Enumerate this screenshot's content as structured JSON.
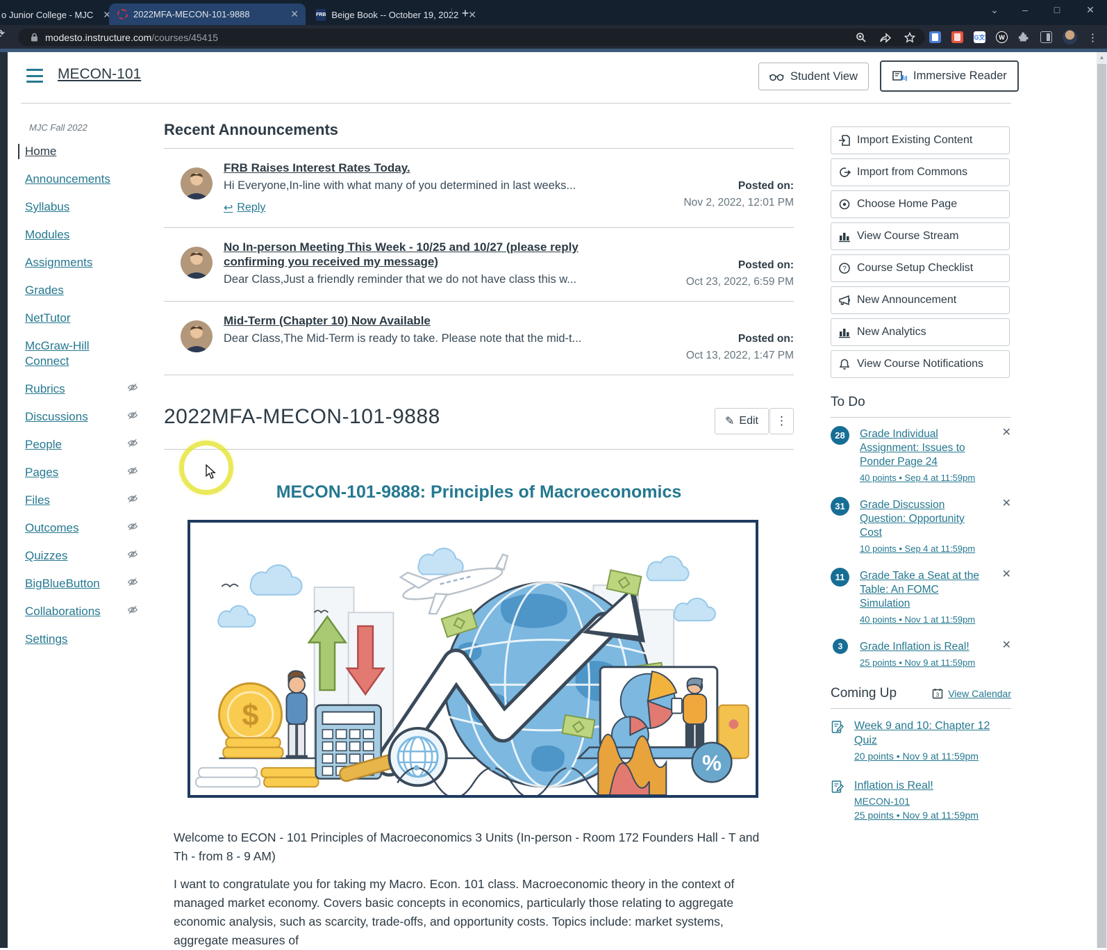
{
  "browser": {
    "tabs": [
      {
        "title": "o Junior College - MJC"
      },
      {
        "title": "2022MFA-MECON-101-9888"
      },
      {
        "title": "Beige Book -- October 19, 2022",
        "favicon": "FRB"
      }
    ],
    "url_host": "modesto.instructure.com",
    "url_path": "/courses/45415"
  },
  "header": {
    "course_link": "MECON-101",
    "student_view": "Student View",
    "immersive_reader": "Immersive Reader"
  },
  "sidebar": {
    "term": "MJC Fall 2022",
    "items": [
      {
        "label": "Home"
      },
      {
        "label": "Announcements"
      },
      {
        "label": "Syllabus"
      },
      {
        "label": "Modules"
      },
      {
        "label": "Assignments"
      },
      {
        "label": "Grades"
      },
      {
        "label": "NetTutor"
      },
      {
        "label": "McGraw-Hill Connect"
      },
      {
        "label": "Rubrics"
      },
      {
        "label": "Discussions"
      },
      {
        "label": "People"
      },
      {
        "label": "Pages"
      },
      {
        "label": "Files"
      },
      {
        "label": "Outcomes"
      },
      {
        "label": "Quizzes"
      },
      {
        "label": "BigBlueButton"
      },
      {
        "label": "Collaborations"
      },
      {
        "label": "Settings"
      }
    ]
  },
  "announcements": {
    "heading": "Recent Announcements",
    "posted_label": "Posted on:",
    "reply_label": "Reply",
    "items": [
      {
        "title": "FRB Raises Interest Rates Today.",
        "preview": "Hi Everyone,In-line with what many of you determined in last weeks...",
        "date": "Nov 2, 2022, 12:01 PM"
      },
      {
        "title": "No In-person Meeting This Week - 10/25 and 10/27 (please reply confirming you received my message)",
        "preview": "Dear Class,Just a friendly reminder that we do not have class this w...",
        "date": "Oct 23, 2022, 6:59 PM"
      },
      {
        "title": "Mid-Term (Chapter 10) Now Available",
        "preview": "Dear Class,The Mid-Term is ready to take. Please note that the mid-t...",
        "date": "Oct 13, 2022, 1:47 PM"
      }
    ]
  },
  "course": {
    "code_heading": "2022MFA-MECON-101-9888",
    "edit_label": "Edit",
    "page_title": "MECON-101-9888: Principles of Macroeconomics",
    "paragraph1": "Welcome to ECON - 101 Principles of Macroeconomics 3 Units (In-person - Room 172 Founders Hall - T and Th - from 8 - 9 AM)",
    "paragraph2": "I want to congratulate you for taking my Macro. Econ. 101 class. Macroeconomic theory in the context of managed market economy. Covers basic concepts in economics, particularly those relating to aggregate economic analysis, such as scarcity, trade-offs, and opportunity costs. Topics include: market systems, aggregate measures of"
  },
  "rail": {
    "actions": [
      {
        "label": "Import Existing Content"
      },
      {
        "label": "Import from Commons"
      },
      {
        "label": "Choose Home Page"
      },
      {
        "label": "View Course Stream"
      },
      {
        "label": "Course Setup Checklist"
      },
      {
        "label": "New Announcement"
      },
      {
        "label": "New Analytics"
      },
      {
        "label": "View Course Notifications"
      }
    ],
    "todo": {
      "heading": "To Do",
      "items": [
        {
          "count": "28",
          "title": "Grade Individual Assignment: Issues to Ponder Page 24",
          "meta": "40 points • Sep 4 at 11:59pm"
        },
        {
          "count": "31",
          "title": "Grade Discussion Question: Opportunity Cost",
          "meta": "10 points • Sep 4 at 11:59pm"
        },
        {
          "count": "11",
          "title": "Grade Take a Seat at the Table: An FOMC Simulation",
          "meta": "40 points • Nov 1 at 11:59pm"
        },
        {
          "count": "3",
          "title": "Grade Inflation is Real!",
          "meta": "25 points • Nov 9 at 11:59pm"
        }
      ]
    },
    "coming_up": {
      "heading": "Coming Up",
      "view_calendar": "View Calendar",
      "calendar_day": "3",
      "items": [
        {
          "title": "Week 9 and 10: Chapter 12 Quiz",
          "course": "",
          "meta": "20 points • Nov 9 at 11:59pm"
        },
        {
          "title": "Inflation is Real!",
          "course": "MECON-101",
          "meta": "25 points • Nov 9 at 11:59pm"
        }
      ]
    }
  }
}
